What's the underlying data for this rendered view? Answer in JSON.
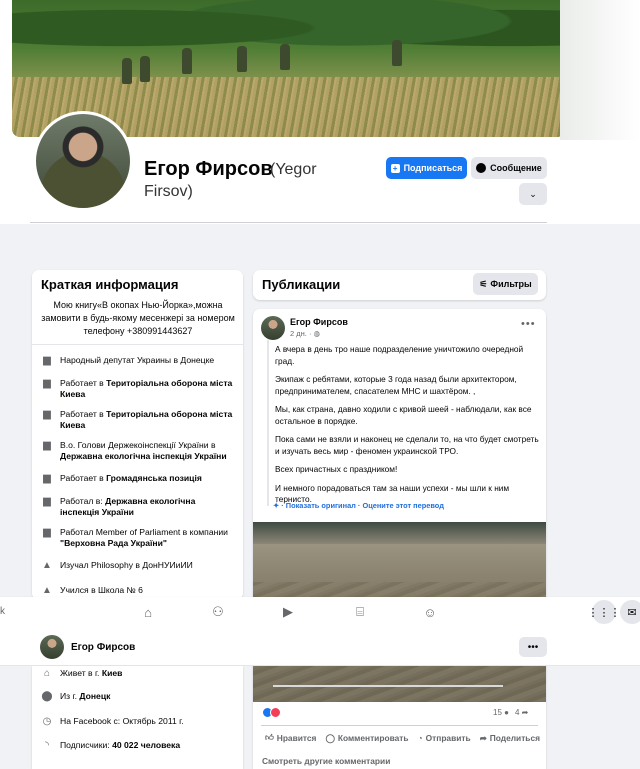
{
  "profile": {
    "name": "Егор Фирсов",
    "name_en_part1": "(Yegor",
    "name_en_part2": "Firsov)",
    "subscribe_label": "Подписаться",
    "message_label": "Сообщение"
  },
  "intro": {
    "title": "Краткая информация",
    "bio": "Мою книгу«В окопах Нью-Йорка»,можна замовити в будь-якому месенжері за номером телефону +380991443627",
    "items": [
      {
        "icon": "briefcase-icon",
        "pre": "Народный депутат Украины в Донецке",
        "bold": "",
        "post": ""
      },
      {
        "icon": "briefcase-icon",
        "pre": "Работает в ",
        "bold": "Територіальна оборона міста Киева",
        "post": ""
      },
      {
        "icon": "briefcase-icon",
        "pre": "Работает в ",
        "bold": "Територіальна оборона міста Киева",
        "post": ""
      },
      {
        "icon": "briefcase-icon",
        "pre": "В.о. Голови Держекоінспекції України в ",
        "bold": "Державна екологічна інспекція України",
        "post": ""
      },
      {
        "icon": "briefcase-icon",
        "pre": "Работает в ",
        "bold": "Громадянська позиція",
        "post": ""
      },
      {
        "icon": "briefcase-icon",
        "pre": "Работал в: ",
        "bold": "Державна екологічна інспекція України",
        "post": ""
      },
      {
        "icon": "briefcase-icon",
        "pre": "Работал Member of Parliament в компании ",
        "bold": "\"Верховна Рада України\"",
        "post": ""
      },
      {
        "icon": "graduation-cap-icon",
        "pre": "Изучал Philosophy в ДонНУИиИИ",
        "bold": "",
        "post": ""
      },
      {
        "icon": "graduation-cap-icon",
        "pre": "Учился в Школа № 6",
        "bold": "",
        "post": ""
      }
    ],
    "lower_items": [
      {
        "icon": "home-icon",
        "pre": "Живет в г. ",
        "bold": "Киев"
      },
      {
        "icon": "location-pin-icon",
        "pre": "Из г. ",
        "bold": "Донецк"
      },
      {
        "icon": "clock-icon",
        "pre": "На Facebook с: Октябрь 2011 г.",
        "bold": ""
      },
      {
        "icon": "rss-icon",
        "pre": "Подписчики: ",
        "bold": "40 022 человека"
      }
    ]
  },
  "publications": {
    "title": "Публикации",
    "filters_label": "Фильтры"
  },
  "post": {
    "author": "Егор Фирсов",
    "time": "2 дн. ·",
    "paragraphs": [
      "А вчера в день тро наше подразделение уничтожило очередной град.",
      "Экипаж с ребятами, которые 3 года назад были архитектором, предпринимателем, спасателем МНС и шахтёром. ,",
      "Мы, как страна, давно ходили с кривой шеей - наблюдали, как все остальное в порядке.",
      "Пока сами не взяли и наконец не сделали то, на что будет смотреть и изучать весь мир - феномен украинской ТРО.",
      "Всех причастных с праздником!",
      "И немного порадоваться там за наши успехи - мы шли к ним тернисто."
    ],
    "translate_label": "· Показать оригинал · Оцените этот перевод",
    "comments_count": "15",
    "shares_count": "4",
    "like_label": "Нравится",
    "comment_label": "Комментировать",
    "send_label": "Отправить",
    "share_label": "Поделиться",
    "more_comments_label": "Смотреть другие комментарии"
  },
  "navbar": {
    "search_fragment": "k"
  },
  "sticky": {
    "name": "Егор Фирсов"
  }
}
